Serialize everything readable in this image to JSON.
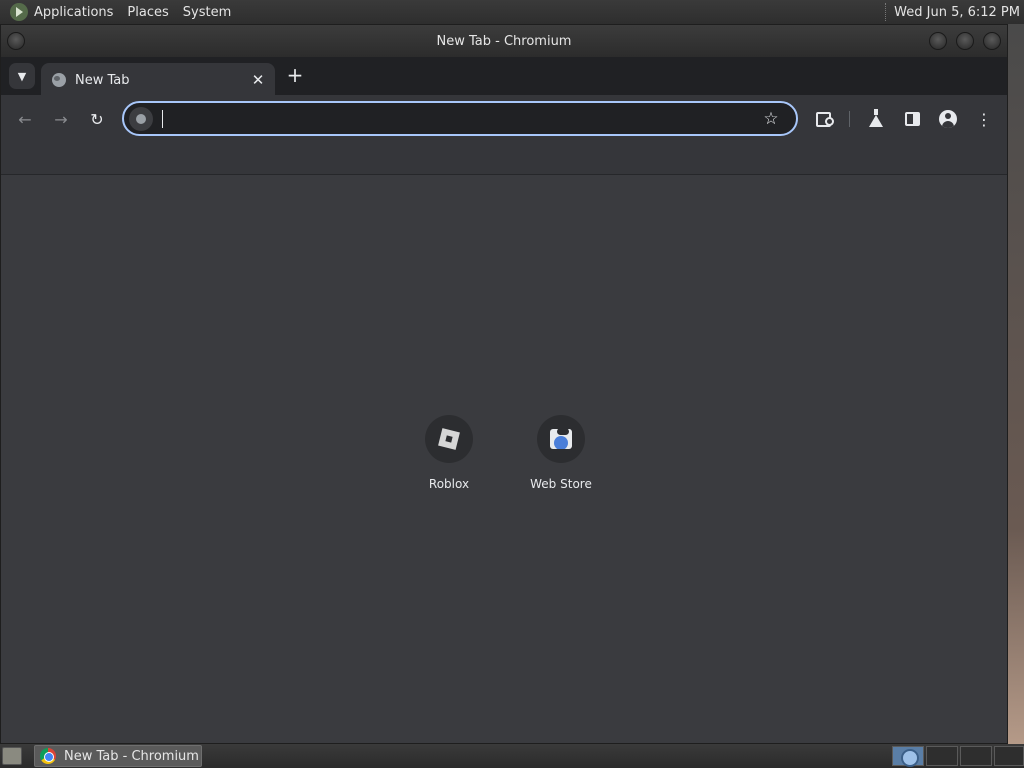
{
  "top_panel": {
    "menus": [
      "Applications",
      "Places",
      "System"
    ],
    "clock": "Wed Jun  5,  6:12 PM"
  },
  "window": {
    "title": "New Tab - Chromium"
  },
  "tabs": [
    {
      "title": "New Tab",
      "active": true
    }
  ],
  "toolbar": {
    "back_icon": "arrow-left-icon",
    "forward_icon": "arrow-right-icon",
    "reload_icon": "reload-icon",
    "omnibox_value": "",
    "bookmark_icon": "star-icon"
  },
  "shortcuts": [
    {
      "label": "Roblox",
      "icon": "roblox-icon"
    },
    {
      "label": "Web Store",
      "icon": "web-store-icon"
    }
  ],
  "taskbar": {
    "task_title": "New Tab - Chromium"
  }
}
